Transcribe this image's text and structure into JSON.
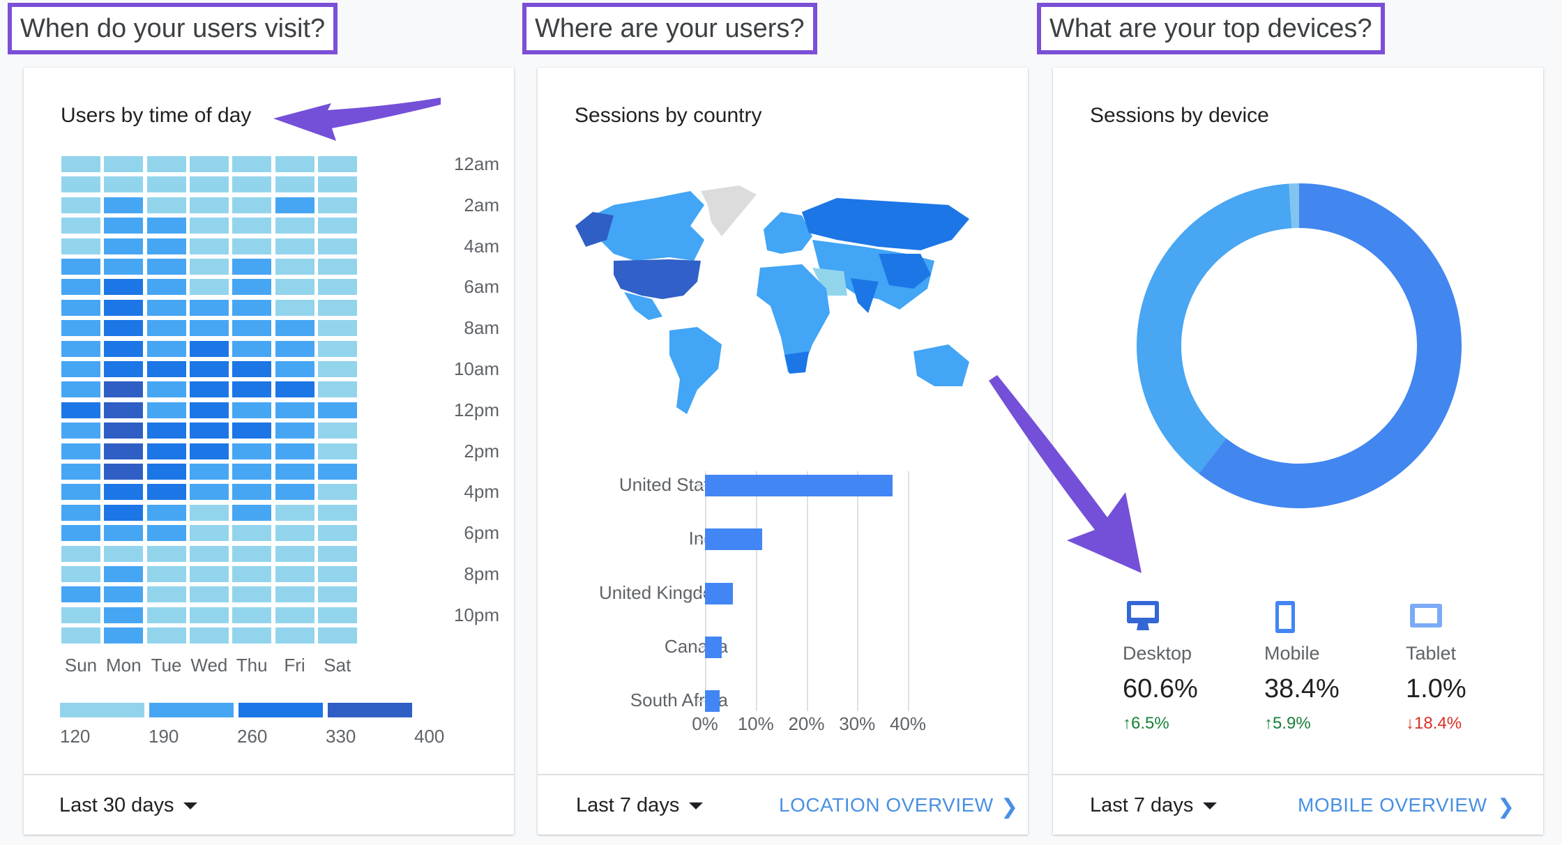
{
  "annotations": {
    "q1": "When do your users visit?",
    "q2": "Where are your users?",
    "q3": "What are your top devices?",
    "arrow_color": "#7450d8"
  },
  "time_card": {
    "title": "Users by time of day",
    "hour_labels": [
      "12am",
      "2am",
      "4am",
      "6am",
      "8am",
      "10am",
      "12pm",
      "2pm",
      "4pm",
      "6pm",
      "8pm",
      "10pm"
    ],
    "days": [
      "Sun",
      "Mon",
      "Tue",
      "Wed",
      "Thu",
      "Fri",
      "Sat"
    ],
    "legend": [
      "120",
      "190",
      "260",
      "330",
      "400"
    ],
    "level_colors": [
      "#93d4ed",
      "#47a6f4",
      "#1c76e6",
      "#2f5ec4"
    ],
    "grid_levels": [
      "0000000",
      "0000000",
      "0100010",
      "0110000",
      "0110000",
      "1110100",
      "1210100",
      "1211100",
      "1211110",
      "1212110",
      "1222210",
      "1312220",
      "2312111",
      "1322210",
      "1322110",
      "1321111",
      "1221110",
      "1210100",
      "1110000",
      "0000000",
      "0100000",
      "1100000",
      "0100000",
      "0100000"
    ],
    "range": "Last 30 days"
  },
  "country_card": {
    "title": "Sessions by country",
    "range": "Last 7 days",
    "link": "LOCATION OVERVIEW",
    "chart_data": {
      "type": "bar",
      "orientation": "horizontal",
      "categories": [
        "United States",
        "India",
        "United Kingdom",
        "Canada",
        "South Africa"
      ],
      "values": [
        37.0,
        11.3,
        5.5,
        3.3,
        2.9
      ],
      "xlim": [
        0,
        40
      ],
      "xticks": [
        "0%",
        "10%",
        "20%",
        "30%",
        "40%"
      ],
      "grid": true,
      "color": "#4285f4"
    }
  },
  "device_card": {
    "title": "Sessions by device",
    "range": "Last 7 days",
    "link": "MOBILE OVERVIEW",
    "chart_data": {
      "type": "pie",
      "donut": true,
      "categories": [
        "Desktop",
        "Mobile",
        "Tablet"
      ],
      "values": [
        60.6,
        38.4,
        1.0
      ],
      "colors": [
        "#4286f0",
        "#48a6f3",
        "#82c4f0"
      ]
    },
    "devices": [
      {
        "name": "Desktop",
        "value": "60.6%",
        "change": "6.5%",
        "dir": "up",
        "icon": "desktop-icon",
        "color": "#3367d6"
      },
      {
        "name": "Mobile",
        "value": "38.4%",
        "change": "5.9%",
        "dir": "up",
        "icon": "mobile-icon",
        "color": "#4285f4"
      },
      {
        "name": "Tablet",
        "value": "1.0%",
        "change": "18.4%",
        "dir": "down",
        "icon": "tablet-icon",
        "color": "#7baaf7"
      }
    ],
    "up_color": "#188038",
    "down_color": "#d93025"
  }
}
